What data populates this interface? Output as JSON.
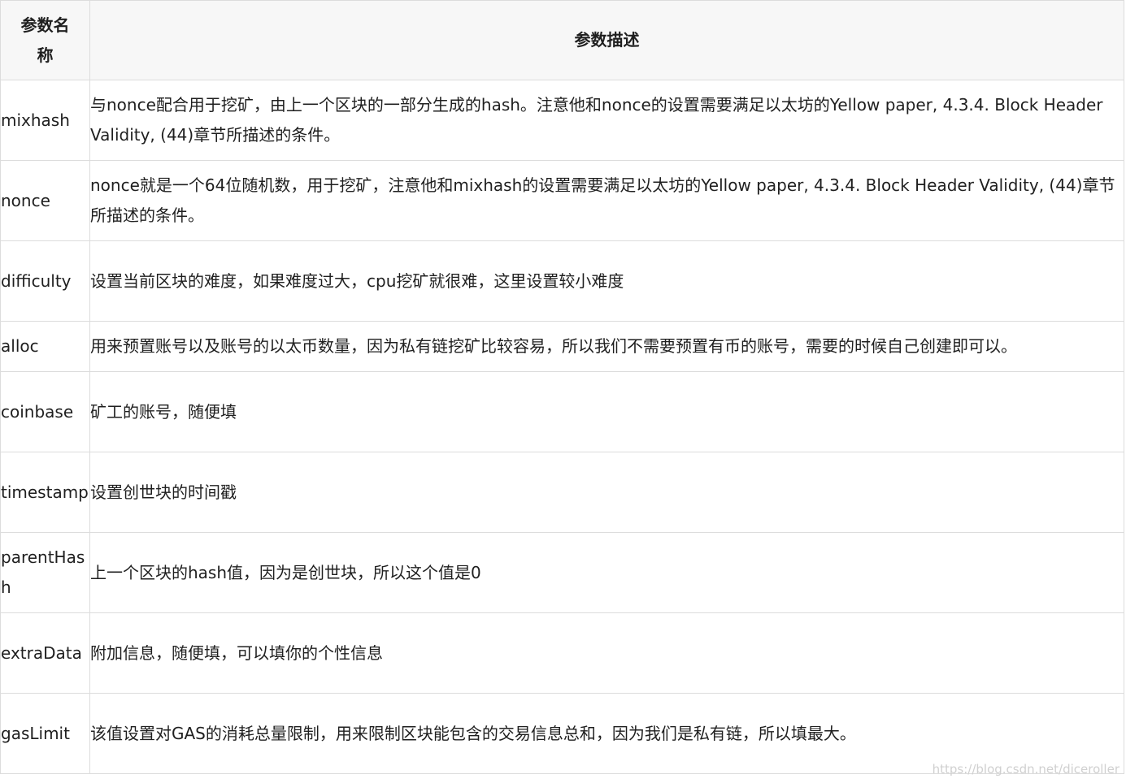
{
  "table": {
    "header": {
      "name": "参数名称",
      "description": "参数描述"
    },
    "rows": [
      {
        "name": "mixhash",
        "description": "与nonce配合用于挖矿，由上一个区块的一部分生成的hash。注意他和nonce的设置需要满足以太坊的Yellow paper, 4.3.4. Block Header Validity, (44)章节所描述的条件。"
      },
      {
        "name": "nonce",
        "description": "nonce就是一个64位随机数，用于挖矿，注意他和mixhash的设置需要满足以太坊的Yellow paper, 4.3.4. Block Header Validity, (44)章节所描述的条件。"
      },
      {
        "name": "difficulty",
        "description": "设置当前区块的难度，如果难度过大，cpu挖矿就很难，这里设置较小难度"
      },
      {
        "name": "alloc",
        "description": "用来预置账号以及账号的以太币数量，因为私有链挖矿比较容易，所以我们不需要预置有币的账号，需要的时候自己创建即可以。"
      },
      {
        "name": "coinbase",
        "description": "矿工的账号，随便填"
      },
      {
        "name": "timestamp",
        "description": "设置创世块的时间戳"
      },
      {
        "name": "parentHash",
        "description": "上一个区块的hash值，因为是创世块，所以这个值是0"
      },
      {
        "name": "extraData",
        "description": "附加信息，随便填，可以填你的个性信息"
      },
      {
        "name": "gasLimit",
        "description": "该值设置对GAS的消耗总量限制，用来限制区块能包含的交易信息总和，因为我们是私有链，所以填最大。"
      }
    ]
  },
  "watermark": "https://blog.csdn.net/diceroller"
}
